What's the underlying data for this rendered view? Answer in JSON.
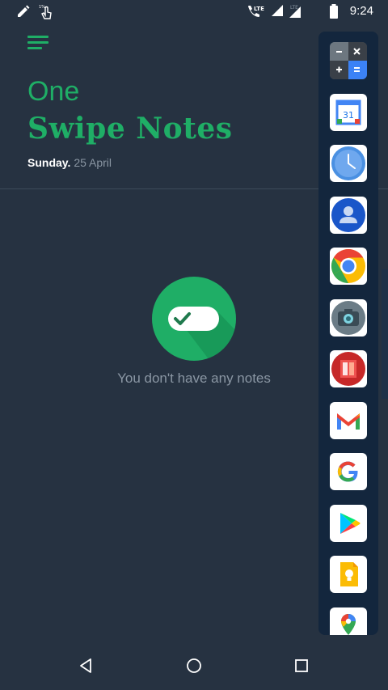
{
  "status_bar": {
    "time": "9:24",
    "left_icons": [
      "pencil-icon",
      "touch-icon"
    ],
    "right_icons": [
      "lte-call-icon",
      "signal-icon",
      "signal-lte-icon",
      "battery-icon"
    ],
    "lte_label": "LTE"
  },
  "header": {
    "menu_icon": "hamburger-menu-icon",
    "title_prefix": "One",
    "title": "Swipe Notes",
    "day": "Sunday.",
    "date": "25 April"
  },
  "empty_state": {
    "icon": "toggle-check-icon",
    "message": "You don't have any notes"
  },
  "app_dock": {
    "apps": [
      {
        "name": "Calculator",
        "icon": "calculator-icon"
      },
      {
        "name": "Calendar",
        "icon": "calendar-icon",
        "label": "31"
      },
      {
        "name": "Clock",
        "icon": "clock-icon"
      },
      {
        "name": "Contacts",
        "icon": "contacts-icon"
      },
      {
        "name": "Chrome",
        "icon": "chrome-icon"
      },
      {
        "name": "Camera",
        "icon": "camera-icon"
      },
      {
        "name": "Office",
        "icon": "office-icon"
      },
      {
        "name": "Gmail",
        "icon": "gmail-icon"
      },
      {
        "name": "Google",
        "icon": "google-icon"
      },
      {
        "name": "Play Store",
        "icon": "play-store-icon"
      },
      {
        "name": "Keep",
        "icon": "keep-icon"
      },
      {
        "name": "Maps",
        "icon": "maps-icon"
      }
    ]
  },
  "nav_bar": {
    "buttons": [
      "back-icon",
      "home-icon",
      "recents-icon"
    ]
  },
  "colors": {
    "background": "#263241",
    "accent": "#1fae66",
    "dock": "#13263d",
    "muted_text": "#8a96a3"
  }
}
